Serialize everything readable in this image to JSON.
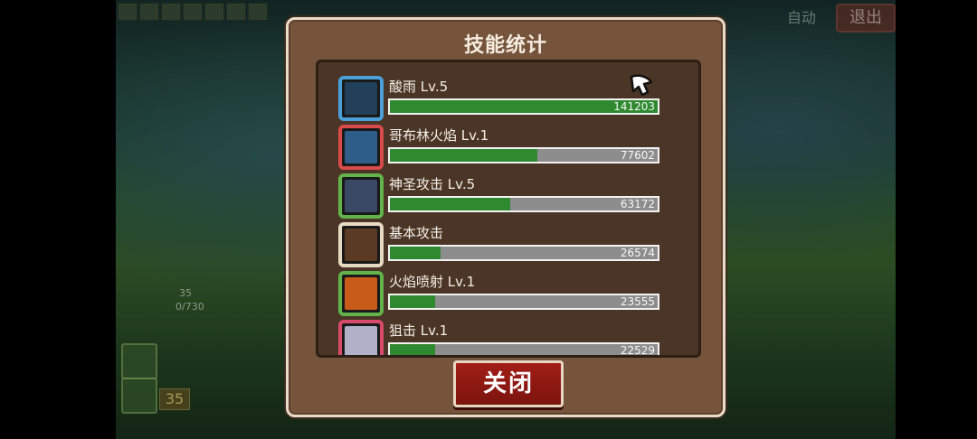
{
  "game": {
    "exit_label": "退出",
    "corner_label": "自动",
    "level_badge": "35",
    "stat_small_1": "35",
    "stat_small_2": "0/730"
  },
  "dialog": {
    "title": "技能统计",
    "close_label": "关闭"
  },
  "skills": [
    {
      "name": "酸雨 Lv.5",
      "damage": "141203",
      "fill_fraction": 1.0,
      "frame_color": "#4aa0d8",
      "icon": "acid-rain-icon"
    },
    {
      "name": "哥布林火焰 Lv.1",
      "damage": "77602",
      "fill_fraction": 0.55,
      "frame_color": "#d94a4a",
      "icon": "goblin-flame-icon"
    },
    {
      "name": "神圣攻击 Lv.5",
      "damage": "63172",
      "fill_fraction": 0.45,
      "frame_color": "#62b34a",
      "icon": "holy-attack-icon"
    },
    {
      "name": "基本攻击",
      "damage": "26574",
      "fill_fraction": 0.19,
      "frame_color": "#e8d9c2",
      "icon": "basic-attack-icon"
    },
    {
      "name": "火焰喷射 Lv.1",
      "damage": "23555",
      "fill_fraction": 0.17,
      "frame_color": "#62b34a",
      "icon": "flamethrower-icon"
    },
    {
      "name": "狙击 Lv.1",
      "damage": "22529",
      "fill_fraction": 0.17,
      "frame_color": "#d94a6a",
      "icon": "snipe-icon"
    }
  ]
}
